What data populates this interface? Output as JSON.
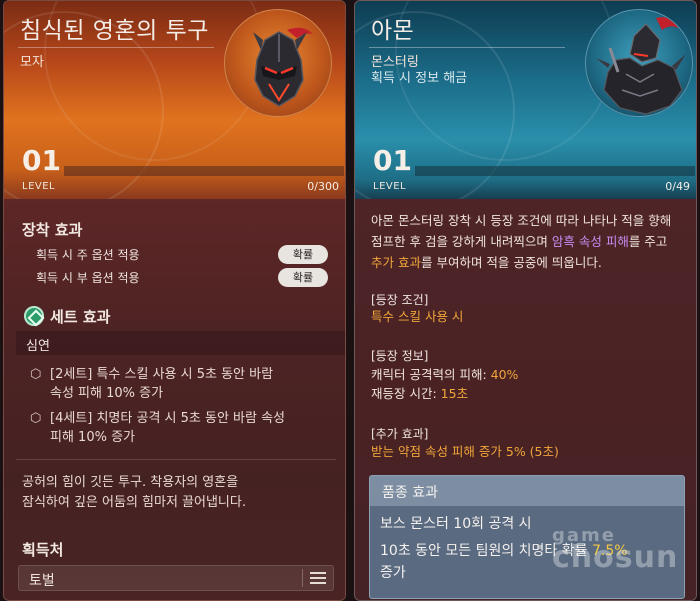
{
  "left": {
    "title": "침식된 영혼의 투구",
    "subtitle": "모자",
    "level_num": "01",
    "level_label": "LEVEL",
    "exp_text": "0/300",
    "exp_fraction": 0,
    "equip_title": "장착 효과",
    "equip_rows": [
      {
        "label": "획득 시 주 옵션 적용",
        "button": "확률"
      },
      {
        "label": "획득 시 부 옵션 적용",
        "button": "확률"
      }
    ],
    "set_title": "세트 효과",
    "set_name": "심연",
    "set_effects": [
      {
        "line1": "[2세트] 특수 스킬 사용 시 5초 동안 바람",
        "line2": "속성 피해 10% 증가"
      },
      {
        "line1": "[4세트] 치명타 공격 시 5초 동안 바람 속성",
        "line2": "피해 10% 증가"
      }
    ],
    "description": [
      "공허의 힘이 깃든 투구. 착용자의 영혼을",
      "잠식하여 깊은 어둠의 힘마저 끌어냅니다."
    ],
    "obtain_title": "획득처",
    "obtain_value": "토벌"
  },
  "right": {
    "title": "아몬",
    "subtitle": "몬스터링",
    "subtitle2": "획득 시 정보 해금",
    "level_num": "01",
    "level_label": "LEVEL",
    "exp_text": "0/49",
    "exp_fraction": 0,
    "desc": {
      "l1": "아몬 몬스터링 장착 시 등장 조건에 따라 나타나 적을 향해",
      "l2a": "점프한 후 검을 강하게 내려찍으며 ",
      "l2b": "암흑 속성 피해",
      "l2c": "를 주고",
      "l3a": "추가 효과",
      "l3b": "를 부여하며 적을 공중에 띄웁니다."
    },
    "cond_title": "[등장 조건]",
    "cond_value": "특수 스킬 사용 시",
    "info_title": "[등장 정보]",
    "info_lines": [
      {
        "label": "캐릭터 공격력의 피해: ",
        "value": "40%"
      },
      {
        "label": "재등장 시간: ",
        "value": "15초"
      }
    ],
    "extra_title": "[추가 효과]",
    "extra_value": "받는 약점 속성 피해 증가 5% (5초)",
    "grade_title": "품종 효과",
    "grade_line1": "보스 몬스터 10회 공격 시",
    "grade_line2a": "10초 동안 모든 팀원의 치명타 확률 ",
    "grade_line2b": "7.5%",
    "grade_line3": "증가"
  },
  "watermark": {
    "line1": "game",
    "line2": "chosun"
  },
  "colors": {
    "orange_accent": "#f0a63a",
    "purple_accent": "#c98bf0",
    "set_icon": "#2e9c6a"
  }
}
